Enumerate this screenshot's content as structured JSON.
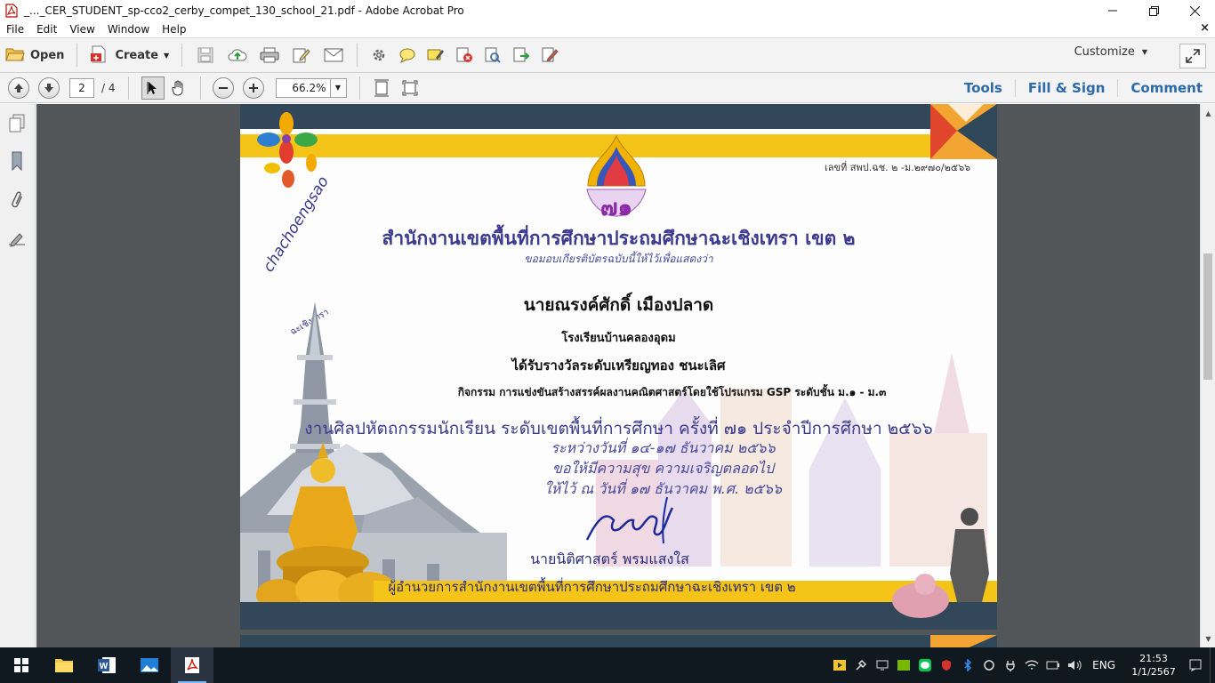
{
  "window": {
    "title": "_..._CER_STUDENT_sp-cco2_cerby_compet_130_school_21.pdf - Adobe Acrobat Pro"
  },
  "menu": {
    "items": [
      "File",
      "Edit",
      "View",
      "Window",
      "Help"
    ],
    "close_glyph": "×"
  },
  "toolbar": {
    "open_label": "Open",
    "create_label": "Create",
    "customize_label": "Customize"
  },
  "nav": {
    "current_page": "2",
    "total_pages": "/ 4",
    "zoom": "66.2%",
    "links": [
      "Tools",
      "Fill & Sign",
      "Comment"
    ]
  },
  "certificate": {
    "doc_number": "เลขที่ สพป.ฉช. ๒ -ม.๒๙๗๐/๒๕๖๖",
    "logo_number": "๗๑",
    "organization": "สำนักงานเขตพื้นที่การศึกษาประถมศึกษาฉะเชิงเทรา เขต ๒",
    "intro": "ขอมอบเกียรติบัตรฉบับนี้ให้ไว้เพื่อแสดงว่า",
    "recipient": "นายณรงค์ศักดิ์ เมืองปลาด",
    "school": "โรงเรียนบ้านคลองอุดม",
    "award": "ได้รับรางวัลระดับเหรียญทอง ชนะเลิศ",
    "activity": "กิจกรรม การแข่งขันสร้างสรรค์ผลงานคณิตศาสตร์โดยใช้โปรแกรม GSP ระดับชั้น ม.๑ - ม.๓",
    "event": "งานศิลปหัตถกรรมนักเรียน ระดับเขตพื้นที่การศึกษา ครั้งที่ ๗๑ ประจำปีการศึกษา ๒๕๖๖",
    "dates": "ระหว่างวันที่ ๑๔-๑๗ ธันวาคม ๒๕๖๖",
    "wish": "ขอให้มีความสุข ความเจริญตลอดไป",
    "given": "ให้ไว้ ณ วันที่ ๑๗ ธันวาคม พ.ศ. ๒๕๖๖",
    "province_script_en": "chachoengsao",
    "province_script_th": "ฉะเชิงเทรา",
    "signer": "นายนิติศาสตร์ พรมแสงใส",
    "signer_position": "ผู้อำนวยการสำนักงานเขตพื้นที่การศึกษาประถมศึกษาฉะเชิงเทรา เขต ๒"
  },
  "taskbar": {
    "language": "ENG",
    "time": "21:53",
    "date": "1/1/2567"
  },
  "colors": {
    "accent_link": "#2d6aa8",
    "cert_navy": "#33475a",
    "cert_gold": "#f5c419",
    "cert_text_purple": "#3c3a8f"
  }
}
